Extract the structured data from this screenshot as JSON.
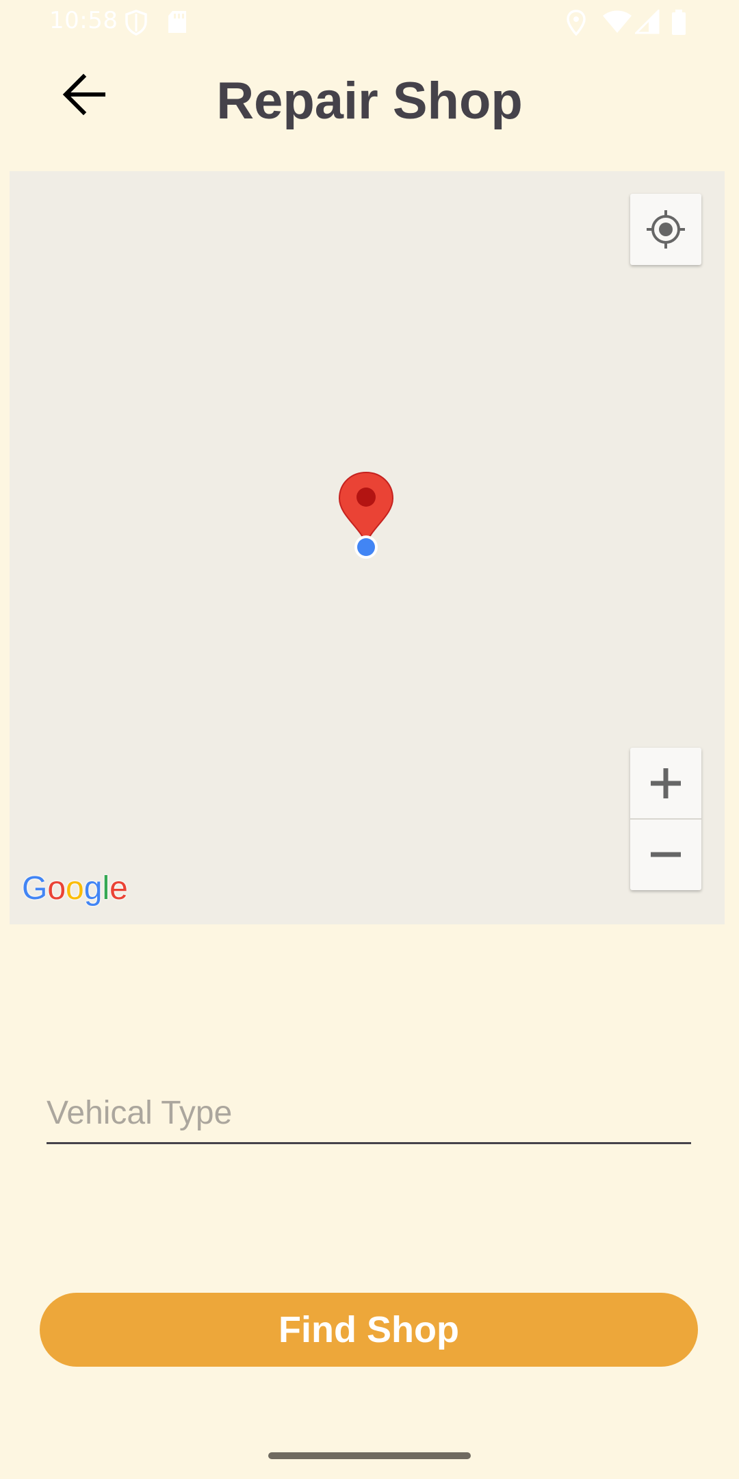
{
  "status_bar": {
    "time": "10:58",
    "icons": [
      "shield-icon",
      "sd-card-icon",
      "location-icon",
      "wifi-icon",
      "signal-icon",
      "battery-icon"
    ]
  },
  "header": {
    "back_icon": "arrow-left-icon",
    "title": "Repair Shop"
  },
  "map": {
    "locate_icon": "my-location-icon",
    "zoom_in_icon": "plus-icon",
    "zoom_out_icon": "minus-icon",
    "marker_icon": "map-pin-icon",
    "attribution": "Google"
  },
  "form": {
    "vehicle_type_placeholder": "Vehical Type",
    "vehicle_type_value": ""
  },
  "actions": {
    "find_shop_label": "Find Shop"
  },
  "colors": {
    "background": "#fdf6e1",
    "accent": "#eda73a",
    "title": "#45424a",
    "marker": "#ea4335",
    "user_location": "#4285f4"
  }
}
